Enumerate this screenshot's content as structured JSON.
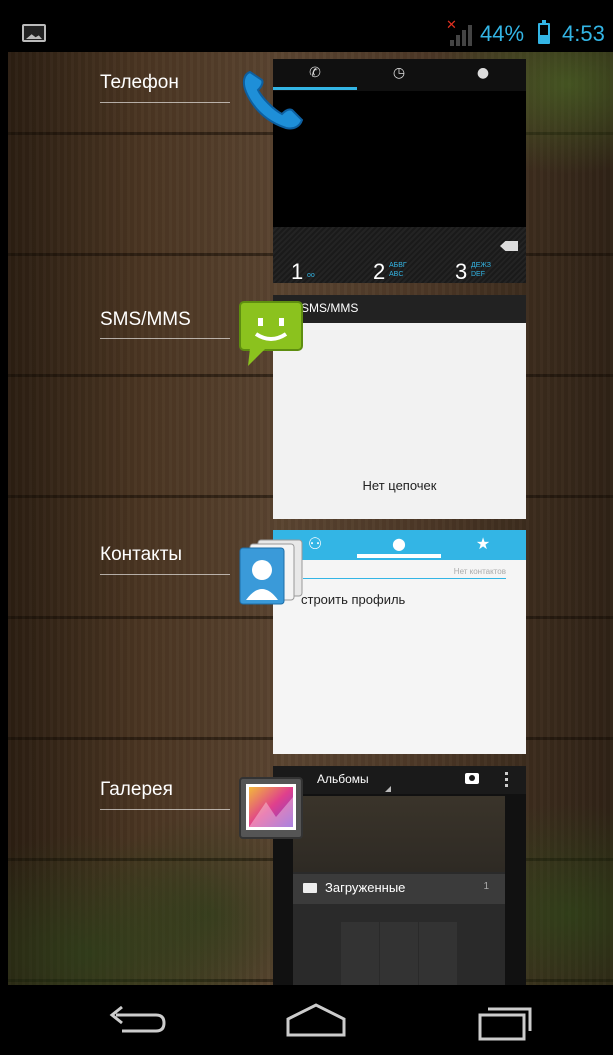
{
  "status_bar": {
    "battery_text": "44%",
    "battery_level": 0.44,
    "time": "4:53",
    "icons": [
      "gallery-notification-icon",
      "signal-no-sim-icon",
      "battery-icon"
    ]
  },
  "recent_apps": [
    {
      "label": "Телефон",
      "icon": "phone-icon",
      "thumbnail": {
        "tabs": [
          "phone-tab-icon",
          "recent-calls-tab-icon",
          "contacts-tab-icon"
        ],
        "keys": [
          {
            "digit": "1",
            "sub": "oo"
          },
          {
            "digit": "2",
            "sub": "АБВГ\nABC"
          },
          {
            "digit": "3",
            "sub": "ДЕЖЗ\nDEF"
          }
        ]
      }
    },
    {
      "label": "SMS/MMS",
      "icon": "sms-icon",
      "thumbnail": {
        "title": "SMS/MMS",
        "empty_text": "Нет цепочек"
      }
    },
    {
      "label": "Контакты",
      "icon": "contacts-icon",
      "thumbnail": {
        "count_text": "Нет контактов",
        "setup_text": "строить профиль"
      }
    },
    {
      "label": "Галерея",
      "icon": "gallery-icon",
      "thumbnail": {
        "title": "Альбомы",
        "album_name": "Загруженные",
        "album_count": "1"
      }
    }
  ],
  "nav_bar": [
    "back-button",
    "home-button",
    "recents-button"
  ],
  "colors": {
    "accent": "#33b5e5",
    "statusbar": "#000000",
    "navbar": "#000000"
  }
}
